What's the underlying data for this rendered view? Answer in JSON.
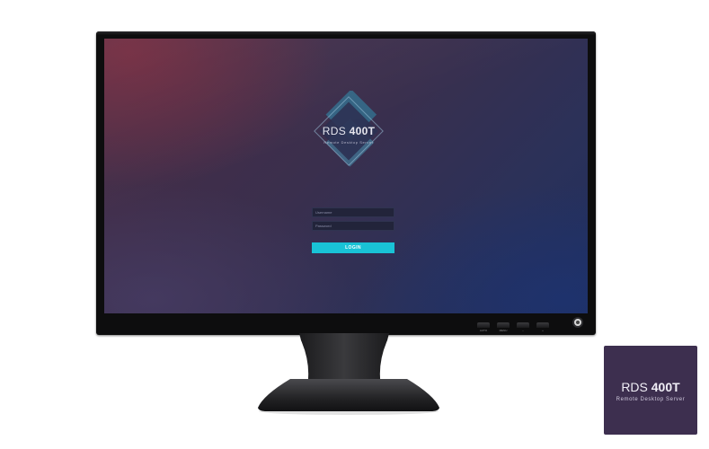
{
  "brand": {
    "name_light": "RDS ",
    "name_bold": "400T",
    "subtitle": "Remote Desktop Server"
  },
  "login": {
    "username_placeholder": "Username",
    "password_placeholder": "Password",
    "button_label": "LOGIN",
    "accent_color": "#19c3d6"
  },
  "monitor_controls": {
    "labels": [
      "AUTO",
      "MENU",
      "–",
      "+"
    ],
    "icon": "power-icon"
  },
  "thumbnail": {
    "name_light": "RDS ",
    "name_bold": "400T",
    "subtitle": "Remote Desktop Server",
    "background": "#3d2f4f"
  }
}
